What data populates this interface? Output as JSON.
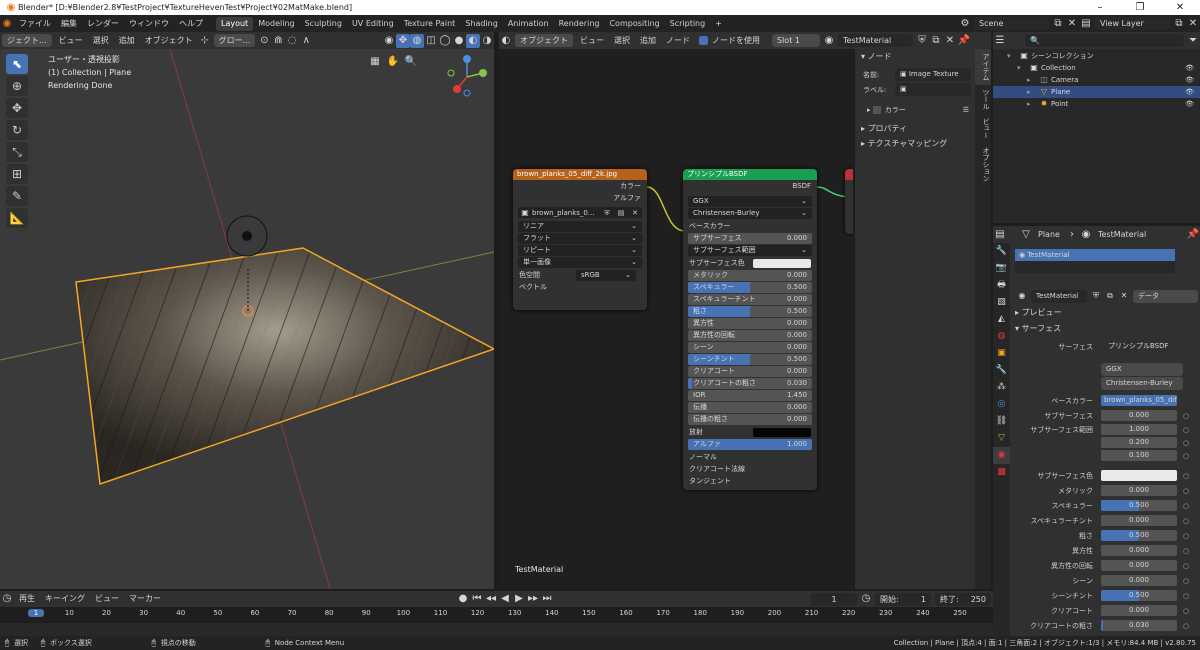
{
  "titlebar": {
    "title": "Blender* [D:¥Blender2.8¥TestProject¥TextureHevenTest¥Project¥02MatMake.blend]"
  },
  "menu": {
    "items": [
      "ファイル",
      "編集",
      "レンダー",
      "ウィンドウ",
      "ヘルプ"
    ]
  },
  "workspaces": [
    "Layout",
    "Modeling",
    "Sculpting",
    "UV Editing",
    "Texture Paint",
    "Shading",
    "Animation",
    "Rendering",
    "Compositing",
    "Scripting"
  ],
  "top_right": {
    "scene": "Scene",
    "view_layer": "View Layer"
  },
  "viewport": {
    "header": {
      "mode": "ジェクト...",
      "items": [
        "ビュー",
        "選択",
        "追加",
        "オブジェクト"
      ],
      "orientation": "グロー..."
    },
    "overlay_lines": [
      "ユーザー・透視投影",
      "(1) Collection | Plane",
      "Rendering Done"
    ]
  },
  "node_editor": {
    "header": {
      "mode": "オブジェクト",
      "items": [
        "ビュー",
        "選択",
        "追加",
        "ノード"
      ],
      "use_nodes": "ノードを使用",
      "slot": "Slot 1",
      "material": "TestMaterial"
    },
    "footer_label": "TestMaterial",
    "image_node": {
      "title": "brown_planks_05_diff_2k.jpg",
      "outputs": [
        "カラー",
        "アルファ"
      ],
      "image": "brown_planks_0...",
      "dropdowns": [
        "リニア",
        "フラット",
        "リピート",
        "単一画像"
      ],
      "colorspace_label": "色空間",
      "colorspace": "sRGB",
      "input": "ベクトル"
    },
    "bsdf_node": {
      "title": "プリンシプルBSDF",
      "output": "BSDF",
      "dist": "GGX",
      "sss_method": "Christensen-Burley",
      "base_color": "ベースカラー",
      "rows": [
        {
          "label": "サブサーフェス",
          "value": "0.000",
          "fill": 0
        },
        {
          "label": "サブサーフェス範囲",
          "value": "",
          "fill": 0
        },
        {
          "label": "サブサーフェス色",
          "value": "",
          "fill": 0
        },
        {
          "label": "メタリック",
          "value": "0.000",
          "fill": 0
        },
        {
          "label": "スペキュラー",
          "value": "0.500",
          "fill": 0.5
        },
        {
          "label": "スペキュラーチント",
          "value": "0.000",
          "fill": 0
        },
        {
          "label": "粗さ",
          "value": "0.500",
          "fill": 0.5
        },
        {
          "label": "異方性",
          "value": "0.000",
          "fill": 0
        },
        {
          "label": "異方性の回転",
          "value": "0.000",
          "fill": 0
        },
        {
          "label": "シーン",
          "value": "0.000",
          "fill": 0
        },
        {
          "label": "シーンチント",
          "value": "0.500",
          "fill": 0.5
        },
        {
          "label": "クリアコート",
          "value": "0.000",
          "fill": 0
        },
        {
          "label": "クリアコートの粗さ",
          "value": "0.030",
          "fill": 0.03
        },
        {
          "label": "IOR",
          "value": "1.450",
          "fill": 0
        },
        {
          "label": "伝播",
          "value": "0.000",
          "fill": 0
        },
        {
          "label": "伝播の粗さ",
          "value": "0.000",
          "fill": 0
        },
        {
          "label": "放射",
          "value": "",
          "fill": 0
        },
        {
          "label": "アルファ",
          "value": "1.000",
          "fill": 1
        }
      ],
      "inputs_tail": [
        "ノーマル",
        "クリアコート法線",
        "タンジェント"
      ]
    }
  },
  "npanel": {
    "section": "ノード",
    "name_label": "名前:",
    "name_value": "Image Texture",
    "label_label": "ラベル:",
    "color": "カラー",
    "props": "プロパティ",
    "texmap": "テクスチャマッピング",
    "tabs": [
      "アイテム",
      "ツール",
      "ビュー",
      "オプション"
    ]
  },
  "outliner": {
    "rows": [
      {
        "name": "シーンコレクション",
        "indent": 0,
        "icon": "▣"
      },
      {
        "name": "Collection",
        "indent": 1,
        "icon": "▣"
      },
      {
        "name": "Camera",
        "indent": 2,
        "icon": "◫"
      },
      {
        "name": "Plane",
        "indent": 2,
        "icon": "▽"
      },
      {
        "name": "Point",
        "indent": 2,
        "icon": "✹"
      }
    ]
  },
  "properties": {
    "header_object": "Plane",
    "header_material": "TestMaterial",
    "slot_name": "TestMaterial",
    "mat_field": "TestMaterial",
    "data_label": "データ",
    "preview": "プレビュー",
    "surface": "サーフェス",
    "surface_label": "サーフェス",
    "surface_value": "プリンシプルBSDF",
    "dist": "GGX",
    "sss_method": "Christensen-Burley",
    "base_color_label": "ベースカラー",
    "base_color_value": "brown_planks_05_diff...",
    "rows": [
      {
        "label": "サブサーフェス",
        "value": "0.000",
        "fill": 0
      },
      {
        "label": "サブサーフェス範囲",
        "value": "1.000",
        "fill": 0
      },
      {
        "label": "",
        "value": "0.200",
        "fill": 0
      },
      {
        "label": "",
        "value": "0.100",
        "fill": 0
      },
      {
        "label": "サブサーフェス色",
        "value": "",
        "fill": 0,
        "white": true
      },
      {
        "label": "メタリック",
        "value": "0.000",
        "fill": 0
      },
      {
        "label": "スペキュラー",
        "value": "0.500",
        "fill": 0.5
      },
      {
        "label": "スペキュラーチント",
        "value": "0.000",
        "fill": 0
      },
      {
        "label": "粗さ",
        "value": "0.500",
        "fill": 0.5
      },
      {
        "label": "異方性",
        "value": "0.000",
        "fill": 0
      },
      {
        "label": "異方性の回転",
        "value": "0.000",
        "fill": 0
      },
      {
        "label": "シーン",
        "value": "0.000",
        "fill": 0
      },
      {
        "label": "シーンチント",
        "value": "0.500",
        "fill": 0.5
      },
      {
        "label": "クリアコート",
        "value": "0.000",
        "fill": 0
      },
      {
        "label": "クリアコートの粗さ",
        "value": "0.030",
        "fill": 0.03
      }
    ]
  },
  "timeline": {
    "menu": [
      "再生",
      "キーイング",
      "ビュー",
      "マーカー"
    ],
    "current_frame": "1",
    "start_label": "開始:",
    "start": "1",
    "end_label": "終了:",
    "end": "250",
    "ticks": [
      "1",
      "10",
      "20",
      "30",
      "40",
      "50",
      "60",
      "70",
      "80",
      "90",
      "100",
      "110",
      "120",
      "130",
      "140",
      "150",
      "160",
      "170",
      "180",
      "190",
      "200",
      "210",
      "220",
      "230",
      "240",
      "250"
    ]
  },
  "status": {
    "select": "選択",
    "box": "ボックス選択",
    "move": "視点の移動",
    "context": "Node Context Menu",
    "info": "Collection | Plane | 頂点:4 | 面:1 | 三角面:2 | オブジェクト:1/3 | メモリ:84.4 MB | v2.80.75"
  },
  "colors": {
    "accent": "#4772b3",
    "image_node": "#b6621d",
    "bsdf_node": "#1a9e4f",
    "selection": "#f5a623"
  }
}
